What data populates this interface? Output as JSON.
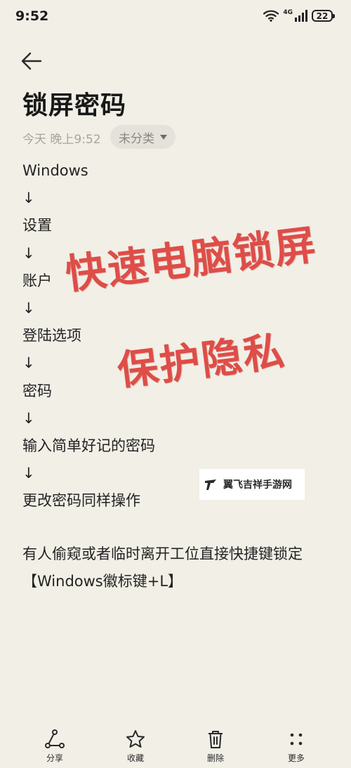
{
  "status": {
    "time": "9:52",
    "network": "4G",
    "battery": "22"
  },
  "note": {
    "title": "锁屏密码",
    "time": "今天 晚上9:52",
    "category": "未分类",
    "lines": [
      "Windows",
      "↓",
      "设置",
      "↓",
      "账户",
      "↓",
      "登陆选项",
      "↓",
      "密码",
      "↓",
      "输入简单好记的密码",
      "↓",
      "更改密码同样操作"
    ],
    "paragraph": "有人偷窥或者临时离开工位直接快捷键锁定【Windows徽标键+L】"
  },
  "overlay": {
    "line1": "快速电脑锁屏",
    "line2": "保护隐私"
  },
  "watermark": {
    "text": "翼飞吉祥手游网"
  },
  "toolbar": {
    "share": "分享",
    "favorite": "收藏",
    "delete": "删除",
    "more": "更多"
  }
}
